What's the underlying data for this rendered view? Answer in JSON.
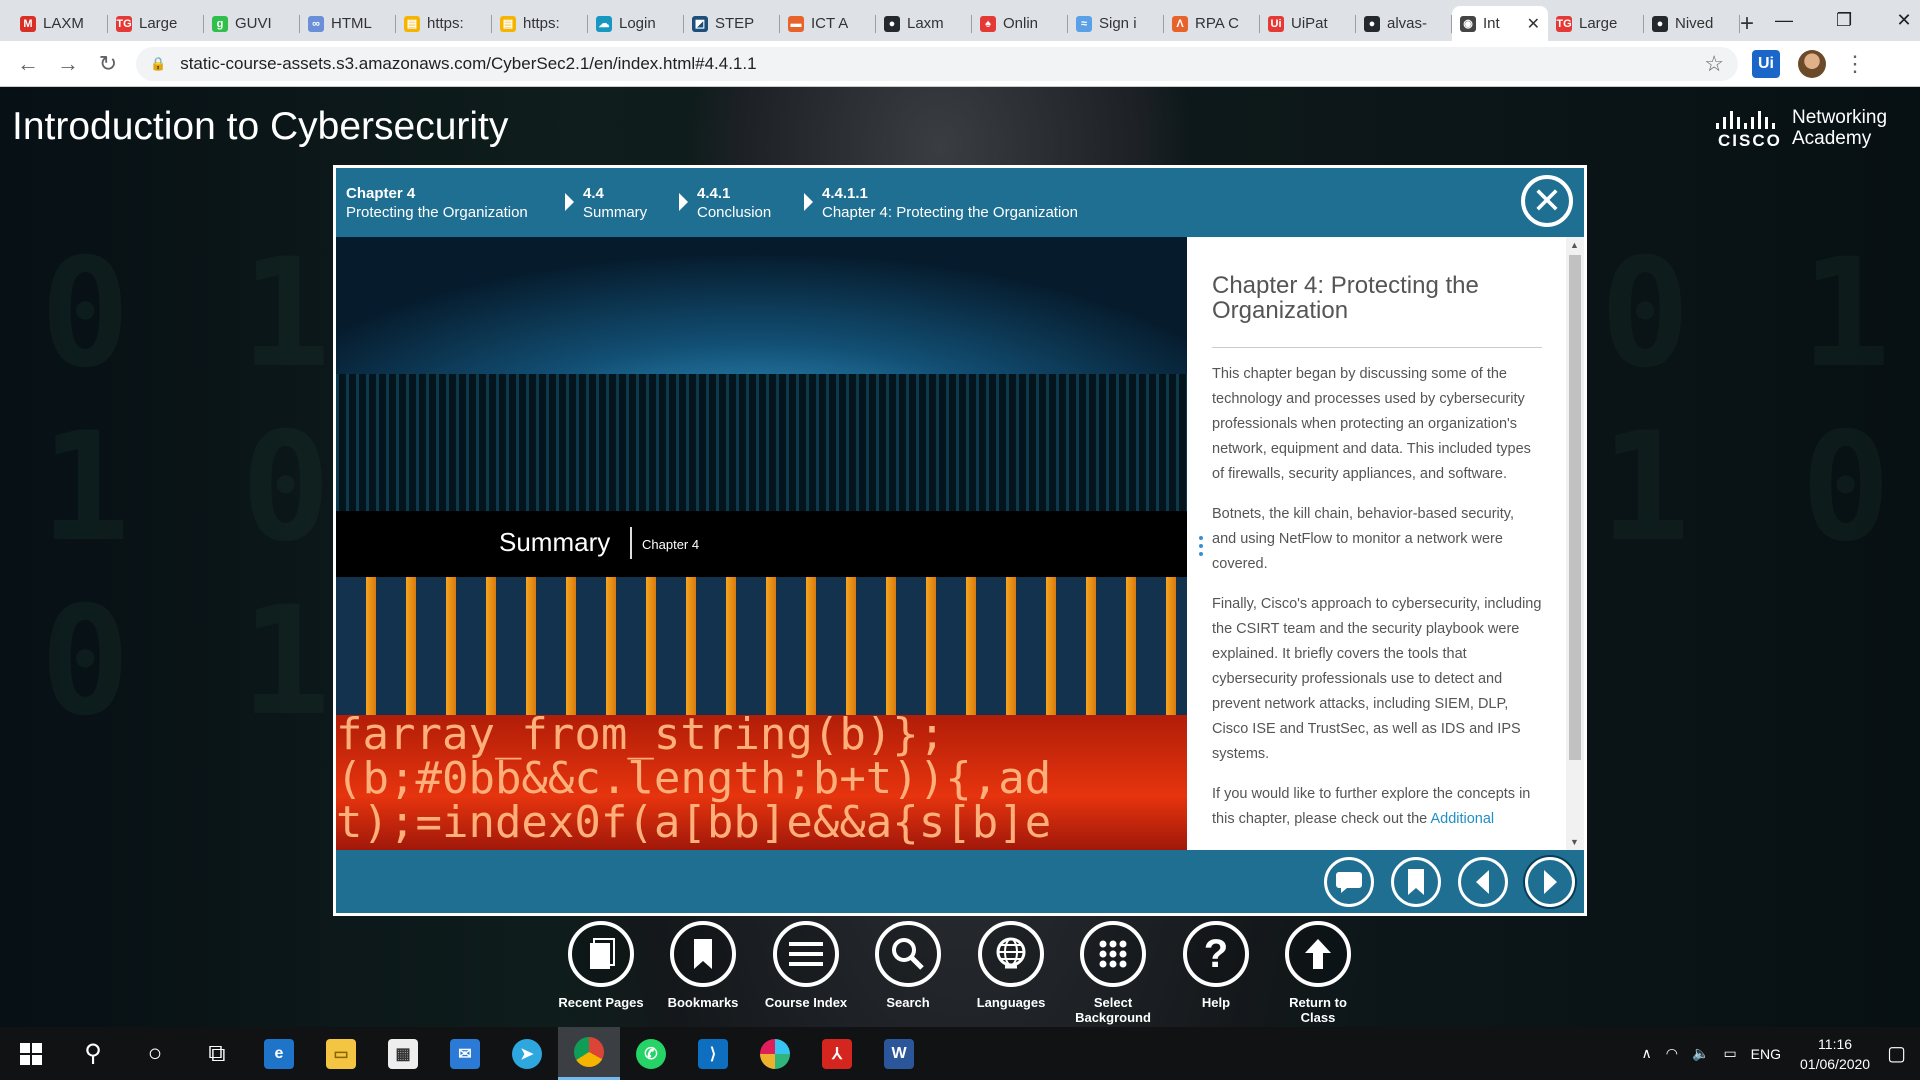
{
  "browser": {
    "tabs": [
      {
        "label": "LAXM",
        "icon": "gmail-icon",
        "color": "#d93025",
        "glyph": "M"
      },
      {
        "label": "Large",
        "icon": "tg-icon",
        "color": "#e53935",
        "glyph": "TG"
      },
      {
        "label": "GUVI",
        "icon": "guvi-icon",
        "color": "#2fbf4a",
        "glyph": "g"
      },
      {
        "label": "HTML",
        "icon": "link-icon",
        "color": "#6a8fd8",
        "glyph": "∞"
      },
      {
        "label": "https:",
        "icon": "folder-icon",
        "color": "#f4b400",
        "glyph": "▤"
      },
      {
        "label": "https:",
        "icon": "folder-icon",
        "color": "#f4b400",
        "glyph": "▤"
      },
      {
        "label": "Login",
        "icon": "salesforce-icon",
        "color": "#1798c1",
        "glyph": "☁"
      },
      {
        "label": "STEP",
        "icon": "step-icon",
        "color": "#1d4f7a",
        "glyph": "◩"
      },
      {
        "label": "ICT A",
        "icon": "ict-icon",
        "color": "#e8632b",
        "glyph": "▬"
      },
      {
        "label": "Laxm",
        "icon": "github-icon",
        "color": "#24292e",
        "glyph": "●"
      },
      {
        "label": "Onlin",
        "icon": "online-icon",
        "color": "#e53935",
        "glyph": "♠"
      },
      {
        "label": "Sign i",
        "icon": "signin-icon",
        "color": "#5aa0e6",
        "glyph": "≈"
      },
      {
        "label": "RPA C",
        "icon": "rpa-icon",
        "color": "#e8632b",
        "glyph": "Λ"
      },
      {
        "label": "UiPat",
        "icon": "uipath-icon",
        "color": "#e53935",
        "glyph": "Ui"
      },
      {
        "label": "alvas-",
        "icon": "github-icon",
        "color": "#24292e",
        "glyph": "●"
      },
      {
        "label": "Int",
        "icon": "globe-icon",
        "color": "#444",
        "glyph": "◉",
        "active": true
      },
      {
        "label": "Large",
        "icon": "tg-icon",
        "color": "#e53935",
        "glyph": "TG"
      },
      {
        "label": "Nived",
        "icon": "github-icon",
        "color": "#24292e",
        "glyph": "●"
      }
    ],
    "url": "static-course-assets.s3.amazonaws.com/CyberSec2.1/en/index.html#4.4.1.1",
    "ext_label": "Ui"
  },
  "site": {
    "title": "Introduction to Cybersecurity",
    "logo_brand": "CISCO",
    "logo_line1": "Networking",
    "logo_line2": "Academy"
  },
  "breadcrumb": [
    {
      "num": "Chapter 4",
      "label": "Protecting the Organization"
    },
    {
      "num": "4.4",
      "label": "Summary"
    },
    {
      "num": "4.4.1",
      "label": "Conclusion"
    },
    {
      "num": "4.4.1.1",
      "label": "Chapter 4: Protecting the Organization"
    }
  ],
  "hero": {
    "summary_title": "Summary",
    "summary_chapter": "Chapter 4",
    "code_lines": [
      "farray_from_string(b)};",
      "(b;#0bb&&c.length;b+t)){,ad",
      "t);=index0f(a[bb]e&&a{s[b]e"
    ]
  },
  "content": {
    "title": "Chapter 4: Protecting the Organization",
    "p1": "This chapter began by discussing some of the technology and processes used by cybersecurity professionals when protecting an organization's network, equipment and data. This included types of firewalls, security appliances, and software.",
    "p2": "Botnets, the kill chain, behavior-based security, and using NetFlow to monitor a network were covered.",
    "p3": "Finally, Cisco's approach to cybersecurity, including the CSIRT team and the security playbook were explained. It briefly covers the tools that cybersecurity professionals use to detect and prevent network attacks, including SIEM, DLP, Cisco ISE and TrustSec, as well as IDS and IPS systems.",
    "p4_start": "If you would like to further explore the concepts in this chapter, please check out the ",
    "p4_link": "Additional"
  },
  "toolbar": [
    {
      "label": "Recent Pages",
      "icon": "recent-pages-icon"
    },
    {
      "label": "Bookmarks",
      "icon": "bookmark-icon"
    },
    {
      "label": "Course Index",
      "icon": "course-index-icon"
    },
    {
      "label": "Search",
      "icon": "search-icon"
    },
    {
      "label": "Languages",
      "icon": "globe-icon"
    },
    {
      "label": "Select Background",
      "icon": "background-grid-icon"
    },
    {
      "label": "Help",
      "icon": "help-icon"
    },
    {
      "label": "Return to Class",
      "icon": "arrow-up-icon"
    }
  ],
  "taskbar": {
    "lang": "ENG",
    "time": "11:16",
    "date": "01/06/2020"
  }
}
